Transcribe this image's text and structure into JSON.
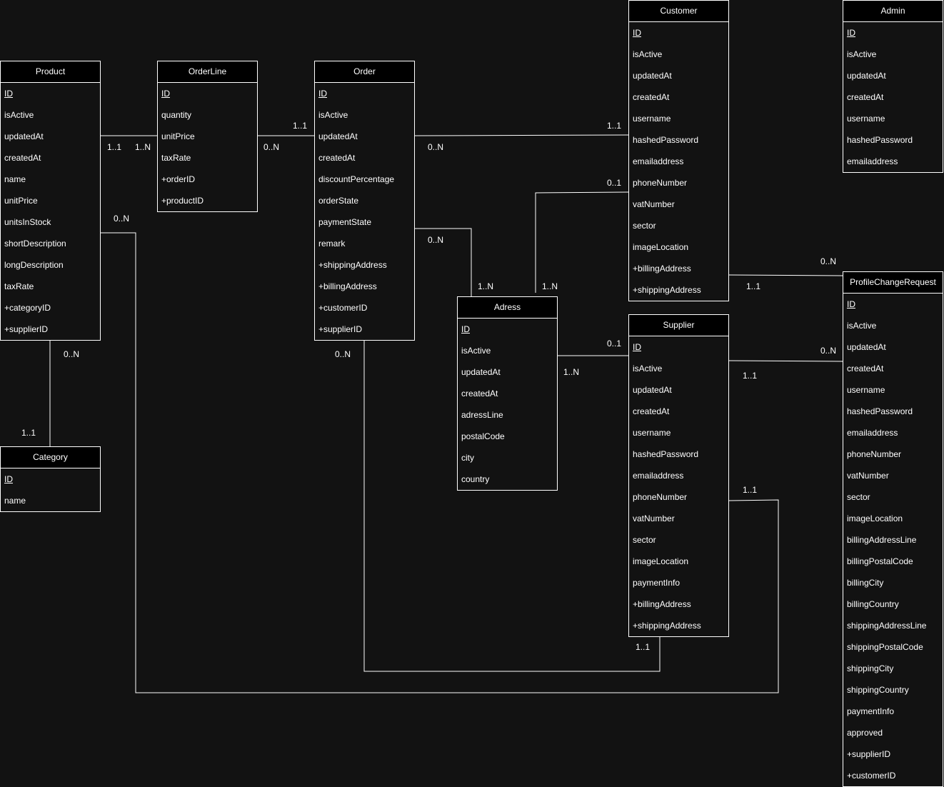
{
  "diagram": {
    "colors": {
      "background": "#121212",
      "header": "#000000",
      "line": "#ffffff",
      "text": "#ffffff"
    },
    "entities": {
      "product": {
        "name": "Product",
        "attributes": [
          "ID",
          "isActive",
          "updatedAt",
          "createdAt",
          "name",
          "unitPrice",
          "unitsInStock",
          "shortDescription",
          "longDescription",
          "taxRate",
          "+categoryID",
          "+supplierID"
        ]
      },
      "orderline": {
        "name": "OrderLine",
        "attributes": [
          "ID",
          "quantity",
          "unitPrice",
          "taxRate",
          "+orderID",
          "+productID"
        ]
      },
      "order": {
        "name": "Order",
        "attributes": [
          "ID",
          "isActive",
          "updatedAt",
          "createdAt",
          "discountPercentage",
          "orderState",
          "paymentState",
          "remark",
          "+shippingAddress",
          "+billingAddress",
          "+customerID",
          "+supplierID"
        ]
      },
      "customer": {
        "name": "Customer",
        "attributes": [
          "ID",
          "isActive",
          "updatedAt",
          "createdAt",
          "username",
          "hashedPassword",
          "emailaddress",
          "phoneNumber",
          "vatNumber",
          "sector",
          "imageLocation",
          "+billingAddress",
          "+shippingAddress"
        ]
      },
      "admin": {
        "name": "Admin",
        "attributes": [
          "ID",
          "isActive",
          "updatedAt",
          "createdAt",
          "username",
          "hashedPassword",
          "emailaddress"
        ]
      },
      "category": {
        "name": "Category",
        "attributes": [
          "ID",
          "name"
        ]
      },
      "adress": {
        "name": "Adress",
        "attributes": [
          "ID",
          "isActive",
          "updatedAt",
          "createdAt",
          "adressLine",
          "postalCode",
          "city",
          "country"
        ]
      },
      "supplier": {
        "name": "Supplier",
        "attributes": [
          "ID",
          "isActive",
          "updatedAt",
          "createdAt",
          "username",
          "hashedPassword",
          "emailaddress",
          "phoneNumber",
          "vatNumber",
          "sector",
          "imageLocation",
          "paymentInfo",
          "+billingAddress",
          "+shippingAddress"
        ]
      },
      "profilechangerequest": {
        "name": "ProfileChangeRequest",
        "attributes": [
          "ID",
          "isActive",
          "updatedAt",
          "createdAt",
          "username",
          "hashedPassword",
          "emailaddress",
          "phoneNumber",
          "vatNumber",
          "sector",
          "imageLocation",
          "billingAddressLine",
          "billingPostalCode",
          "billingCity",
          "billingCountry",
          "shippingAddressLine",
          "shippingPostalCode",
          "shippingCity",
          "shippingCountry",
          "paymentInfo",
          "approved",
          "+supplierID",
          "+customerID"
        ]
      }
    },
    "relationships": [
      {
        "from": "Product",
        "to": "OrderLine",
        "from_card": "1..1",
        "to_card": "1..N"
      },
      {
        "from": "OrderLine",
        "to": "Order",
        "from_card": "0..N",
        "to_card": "1..1"
      },
      {
        "from": "Order",
        "to": "Customer",
        "from_card": "0..N",
        "to_card": "1..1"
      },
      {
        "from": "Order",
        "to": "Adress",
        "from_card": "0..N",
        "to_card": "1..N"
      },
      {
        "from": "Adress",
        "to": "Customer",
        "from_card": "1..N",
        "to_card": "0..1"
      },
      {
        "from": "Adress",
        "to": "Supplier",
        "from_card": "1..N",
        "to_card": "0..1"
      },
      {
        "from": "Product",
        "to": "Category",
        "from_card": "0..N",
        "to_card": "1..1"
      },
      {
        "from": "Product",
        "to": "Supplier",
        "from_card": "0..N",
        "to_card": "1..1"
      },
      {
        "from": "Order",
        "to": "Supplier",
        "from_card": "0..N",
        "to_card": "1..1"
      },
      {
        "from": "Customer",
        "to": "ProfileChangeRequest",
        "from_card": "1..1",
        "to_card": "0..N"
      },
      {
        "from": "Supplier",
        "to": "ProfileChangeRequest",
        "from_card": "1..1",
        "to_card": "0..N"
      }
    ]
  }
}
